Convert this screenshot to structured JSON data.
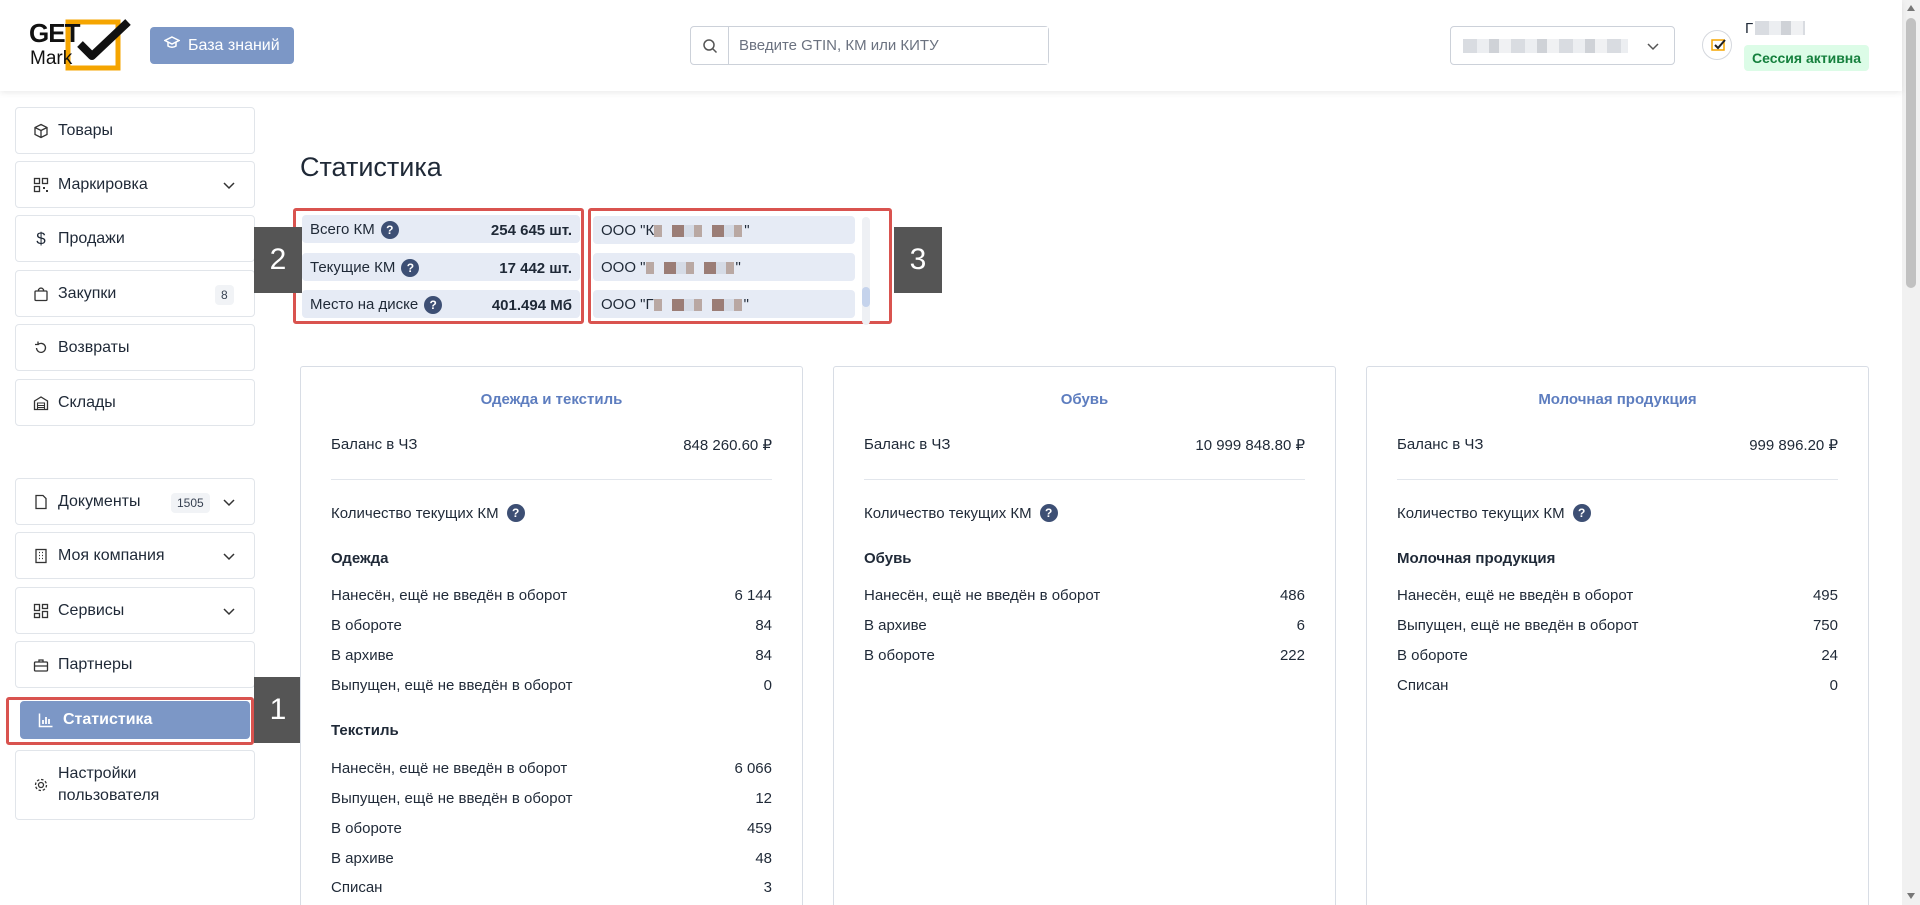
{
  "header": {
    "logo": {
      "line1": "GET",
      "line2": "Mark"
    },
    "kb_button": "База знаний",
    "search": {
      "placeholder": "Введите GTIN, КМ или КИТУ",
      "value": ""
    },
    "user": {
      "initial": "Г",
      "session": "Сессия активна"
    }
  },
  "sidebar": {
    "items": [
      {
        "label": "Товары",
        "icon": "box-icon"
      },
      {
        "label": "Маркировка",
        "icon": "qr-icon"
      },
      {
        "label": "Продажи",
        "icon": "dollar-icon"
      },
      {
        "label": "Закупки",
        "icon": "bag-icon",
        "badge": "8"
      },
      {
        "label": "Возвраты",
        "icon": "return-icon"
      },
      {
        "label": "Склады",
        "icon": "warehouse-icon"
      },
      {
        "label": "Документы",
        "icon": "document-icon",
        "badge": "1505"
      },
      {
        "label": "Моя компания",
        "icon": "building-icon"
      },
      {
        "label": "Сервисы",
        "icon": "services-icon"
      },
      {
        "label": "Партнеры",
        "icon": "partners-icon"
      },
      {
        "label": "Статистика",
        "icon": "chart-icon"
      },
      {
        "label_line1": "Настройки",
        "label_line2": "пользователя",
        "icon": "gear-icon"
      }
    ]
  },
  "markers": [
    "1",
    "2",
    "3"
  ],
  "main": {
    "title": "Статистика",
    "stats": [
      {
        "label": "Всего КМ",
        "value": "254 645 шт."
      },
      {
        "label": "Текущие КМ",
        "value": "17 442 шт."
      },
      {
        "label": "Место на диске",
        "value": "401.494 Мб"
      }
    ],
    "orgs": [
      {
        "prefix": "ООО \"К",
        "suffix": "\""
      },
      {
        "prefix": "ООО \"",
        "suffix": "\""
      },
      {
        "prefix": "ООО \"Г",
        "suffix": "\""
      }
    ],
    "help_glyph": "?",
    "cards": [
      {
        "title": "Одежда и текстиль",
        "balance_label": "Баланс в ЧЗ",
        "balance_value": "848 260.60 ₽",
        "qty_label": "Количество текущих КМ",
        "groups": [
          {
            "name": "Одежда",
            "rows": [
              {
                "label": "Нанесён, ещё не введён в оборот",
                "value": "6 144"
              },
              {
                "label": "В обороте",
                "value": "84"
              },
              {
                "label": "В архиве",
                "value": "84"
              },
              {
                "label": "Выпущен, ещё не введён в оборот",
                "value": "0"
              }
            ]
          },
          {
            "name": "Текстиль",
            "rows": [
              {
                "label": "Нанесён, ещё не введён в оборот",
                "value": "6 066"
              },
              {
                "label": "Выпущен, ещё не введён в оборот",
                "value": "12"
              },
              {
                "label": "В обороте",
                "value": "459"
              },
              {
                "label": "В архиве",
                "value": "48"
              },
              {
                "label": "Списан",
                "value": "3"
              }
            ]
          }
        ]
      },
      {
        "title": "Обувь",
        "balance_label": "Баланс в ЧЗ",
        "balance_value": "10 999 848.80 ₽",
        "qty_label": "Количество текущих КМ",
        "groups": [
          {
            "name": "Обувь",
            "rows": [
              {
                "label": "Нанесён, ещё не введён в оборот",
                "value": "486"
              },
              {
                "label": "В архиве",
                "value": "6"
              },
              {
                "label": "В обороте",
                "value": "222"
              }
            ]
          }
        ]
      },
      {
        "title": "Молочная продукция",
        "balance_label": "Баланс в ЧЗ",
        "balance_value": "999 896.20 ₽",
        "qty_label": "Количество текущих КМ",
        "groups": [
          {
            "name": "Молочная продукция",
            "rows": [
              {
                "label": "Нанесён, ещё не введён в оборот",
                "value": "495"
              },
              {
                "label": "Выпущен, ещё не введён в оборот",
                "value": "750"
              },
              {
                "label": "В обороте",
                "value": "24"
              },
              {
                "label": "Списан",
                "value": "0"
              }
            ]
          }
        ]
      }
    ]
  },
  "colors": {
    "accent": "#7c97c6",
    "highlight": "#d9534f",
    "card_title": "#5d7dbf",
    "help_icon": "#3d4f74",
    "session_bg": "#dcfce7",
    "session_text": "#15803d"
  }
}
